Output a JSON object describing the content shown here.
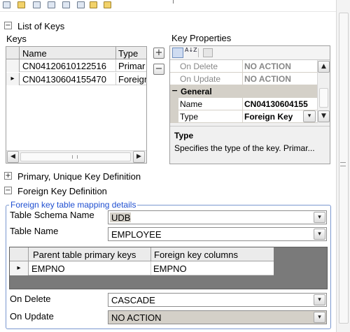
{
  "list_of_keys": {
    "section_title": "List of Keys",
    "keys_label": "Keys",
    "columns": [
      "Name",
      "Type"
    ],
    "rows": [
      {
        "name": "CN04120610122516",
        "type": "Primar"
      },
      {
        "name": "CN04130604155470",
        "type": "Foreigr"
      }
    ],
    "add_symbol": "+",
    "remove_symbol": "−"
  },
  "key_properties": {
    "title": "Key Properties",
    "rows": [
      {
        "name": "On Delete",
        "value": "NO ACTION"
      },
      {
        "name": "On Update",
        "value": "NO ACTION"
      }
    ],
    "group": "General",
    "group_rows": [
      {
        "name": "Name",
        "value": "CN04130604155"
      },
      {
        "name": "Type",
        "value": "Foreign Key"
      }
    ],
    "help_title": "Type",
    "help_text": "Specifies the type of the key. Primar..."
  },
  "primary_unique": {
    "title": "Primary, Unique Key Definition",
    "symbol": "+"
  },
  "foreign_key": {
    "title": "Foreign Key Definition",
    "symbol": "−",
    "group_title": "Foreign key table mapping details",
    "schema_label": "Table Schema Name",
    "schema_value": "UDB",
    "table_label": "Table Name",
    "table_value": "EMPLOYEE",
    "mapping_columns": [
      "Parent table primary keys",
      "Foreign key columns"
    ],
    "mapping_rows": [
      {
        "parent": "EMPNO",
        "foreign": "EMPNO"
      }
    ],
    "on_delete_label": "On Delete",
    "on_delete_value": "CASCADE",
    "on_update_label": "On Update",
    "on_update_value": "NO ACTION"
  },
  "icons": {
    "expand": "+",
    "collapse": "−",
    "row_pointer": "▸",
    "dropdown_arrow": "▾",
    "scroll_up": "▲",
    "scroll_down": "▼",
    "scroll_left": "◀",
    "scroll_right": "▶",
    "sort_az": "A↓Z"
  },
  "colors": {
    "group_title": "#1f4fd1",
    "group_border": "#7a97d0",
    "selected_field": "#d4d0c8",
    "grid_header": "#ebebeb",
    "dark_grid_bg": "#7a7a7a"
  }
}
